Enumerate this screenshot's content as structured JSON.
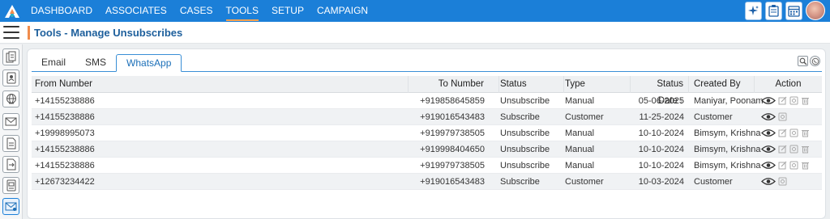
{
  "nav": {
    "items": [
      {
        "label": "DASHBOARD",
        "active": false
      },
      {
        "label": "ASSOCIATES",
        "active": false
      },
      {
        "label": "CASES",
        "active": false
      },
      {
        "label": "TOOLS",
        "active": true
      },
      {
        "label": "SETUP",
        "active": false
      },
      {
        "label": "CAMPAIGN",
        "active": false
      }
    ],
    "right_icons": [
      "sparkle-icon",
      "clipboard-icon",
      "calendar-icon"
    ]
  },
  "header": {
    "title": "Tools - Manage Unsubscribes"
  },
  "rail": {
    "icons": [
      "copy-icon",
      "contact-card-icon",
      "globe-icon",
      "mail-icon",
      "document-icon",
      "document-arrow-icon",
      "id-badge-icon",
      "mail-settings-icon"
    ]
  },
  "tabs": [
    {
      "label": "Email",
      "active": false
    },
    {
      "label": "SMS",
      "active": false
    },
    {
      "label": "WhatsApp",
      "active": true
    }
  ],
  "table": {
    "columns": [
      "From Number",
      "To Number",
      "Status",
      "Type",
      "Status Date",
      "Created By",
      "Action"
    ],
    "sort_column": "Status Date",
    "sort_direction": "descending",
    "rows": [
      {
        "from": "+14155238886",
        "to": "+919858645859",
        "status": "Unsubscribe",
        "type": "Manual",
        "date": "05-06-2025",
        "created_by": "Maniyar, Poonam",
        "actions": [
          "view",
          "edit",
          "settings",
          "delete"
        ]
      },
      {
        "from": "+14155238886",
        "to": "+919016543483",
        "status": "Subscribe",
        "type": "Customer",
        "date": "11-25-2024",
        "created_by": "Customer",
        "actions": [
          "view",
          "settings"
        ]
      },
      {
        "from": "+19998995073",
        "to": "+919979738505",
        "status": "Unsubscribe",
        "type": "Manual",
        "date": "10-10-2024",
        "created_by": "Bimsym, Krishna",
        "actions": [
          "view",
          "edit",
          "settings",
          "delete"
        ]
      },
      {
        "from": "+14155238886",
        "to": "+919998404650",
        "status": "Unsubscribe",
        "type": "Manual",
        "date": "10-10-2024",
        "created_by": "Bimsym, Krishna",
        "actions": [
          "view",
          "edit",
          "settings",
          "delete"
        ]
      },
      {
        "from": "+14155238886",
        "to": "+919979738505",
        "status": "Unsubscribe",
        "type": "Manual",
        "date": "10-10-2024",
        "created_by": "Bimsym, Krishna",
        "actions": [
          "view",
          "edit",
          "settings",
          "delete"
        ]
      },
      {
        "from": "+12673234422",
        "to": "+919016543483",
        "status": "Subscribe",
        "type": "Customer",
        "date": "10-03-2024",
        "created_by": "Customer",
        "actions": [
          "view",
          "settings"
        ]
      }
    ]
  },
  "colors": {
    "nav_bg": "#1b7fd8",
    "active_underline": "#f7a24f",
    "title_text": "#1d5f9c",
    "title_accent": "#f08c4c",
    "tab_border": "#3a8fd6"
  }
}
